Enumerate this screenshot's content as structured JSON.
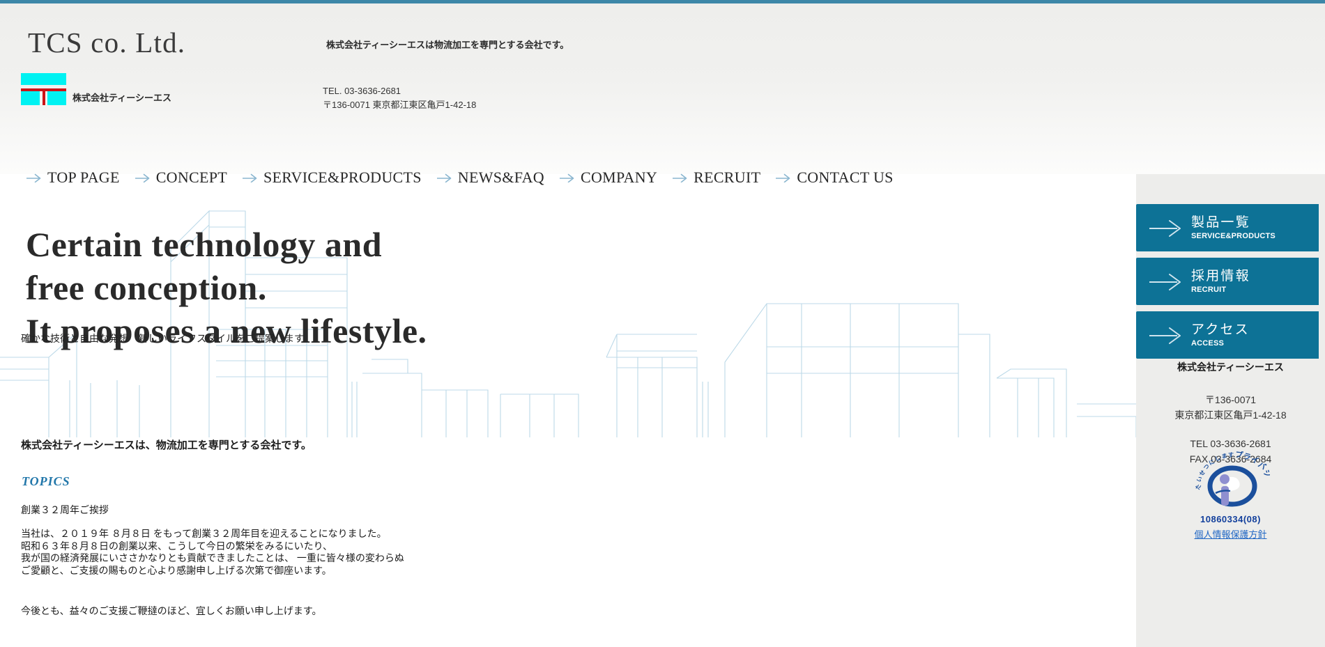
{
  "theme": {
    "accent_bar": "#3d87a8",
    "sidebar_button": "#0d7296",
    "topics_blue": "#2277aa",
    "link_blue": "#1f66c4",
    "logo_cyan": "#00f2f2",
    "logo_red": "#cc1417",
    "skyline_line": "#bcd9e8"
  },
  "header": {
    "wordmark": "TCS co. Ltd.",
    "logo_company_name": "株式会社ティーシーエス",
    "tagline": "株式会社ティーシーエスは物流加工を専門とする会社です。",
    "tel": "TEL. 03-3636-2681",
    "address": "〒136-0071 東京都江東区亀戸1-42-18"
  },
  "nav": {
    "items": [
      {
        "label": "TOP PAGE",
        "name": "top-page"
      },
      {
        "label": "CONCEPT",
        "name": "concept"
      },
      {
        "label": "SERVICE&PRODUCTS",
        "name": "service-products"
      },
      {
        "label": "NEWS&FAQ",
        "name": "news-faq"
      },
      {
        "label": "COMPANY",
        "name": "company"
      },
      {
        "label": "RECRUIT",
        "name": "recruit"
      },
      {
        "label": "CONTACT US",
        "name": "contact-us"
      }
    ]
  },
  "hero": {
    "heading": "Certain technology and\nfree conception.\nIt proposes a new lifestyle.",
    "subheading": "確かな技術と自由な発想　新しいライフスタイルをご提案します"
  },
  "content": {
    "intro": "株式会社ティーシーエスは、物流加工を専門とする会社です。",
    "topics_heading": "TOPICS",
    "topic_title": "創業３２周年ご挨拶",
    "topic_body": "当社は、２０１９年 ８月８日 をもって創業３２周年目を迎えることになりました。\n昭和６３年８月８日の創業以来、こうして今日の繁栄をみるにいたり、\n我が国の経済発展にいささかなりとも貢献できましたことは、 一重に皆々様の変わらぬ\nご愛顧と、ご支援の賜ものと心より感謝申し上げる次第で御座います。",
    "topic_closing": "今後とも、益々のご支援ご鞭撻のほど、宜しくお願い申し上げます。"
  },
  "sidebar": {
    "buttons": [
      {
        "ja": "製品一覧",
        "en": "SERVICE&PRODUCTS",
        "name": "service-products"
      },
      {
        "ja": "採用情報",
        "en": "RECRUIT",
        "name": "recruit"
      },
      {
        "ja": "アクセス",
        "en": "ACCESS",
        "name": "access"
      }
    ],
    "company_name": "株式会社ティーシーエス",
    "address": "〒136-0071\n東京都江東区亀戸1-42-18",
    "phones": "TEL 03-3636-2681\nFAX 03-3636-2684",
    "privacy": {
      "mark_top_text": "たいせつにします",
      "mark_katakana": "プライバシー",
      "number": "10860334(08)",
      "policy_link": "個人情報保護方針"
    }
  }
}
